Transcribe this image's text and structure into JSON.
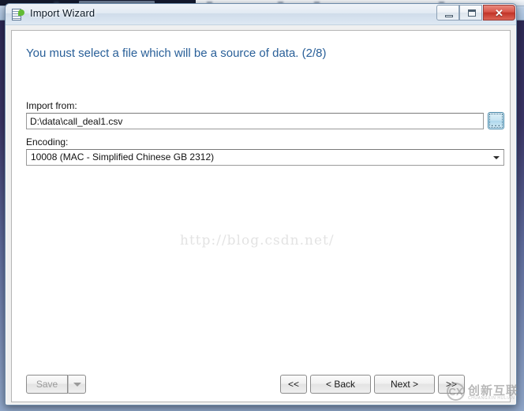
{
  "window": {
    "title": "Import Wizard",
    "icon": "spreadsheet-green-icon",
    "minimize_tooltip": "Minimize",
    "maximize_tooltip": "Maximize",
    "close_label": "✕"
  },
  "content": {
    "headline": "You must select a file which will be a source of data. (2/8)",
    "headline_color": "#2a6099",
    "import": {
      "label": "Import from:",
      "value": "D:\\data\\call_deal1.csv",
      "placeholder": "",
      "browse_label": "..."
    },
    "encoding": {
      "label": "Encoding:",
      "value": "10008 (MAC - Simplified Chinese GB 2312)"
    },
    "watermark": "http://blog.csdn.net/"
  },
  "footer": {
    "save_label": "Save",
    "save_dropdown_icon": "chevron-down-icon",
    "first_label": "<<",
    "back_label": "< Back",
    "next_label": "Next >",
    "last_label": ">>"
  },
  "corner_logo": {
    "mark": "CX",
    "name_cn": "创新互联",
    "name_en": "CHUANGXIN HULIAN"
  }
}
